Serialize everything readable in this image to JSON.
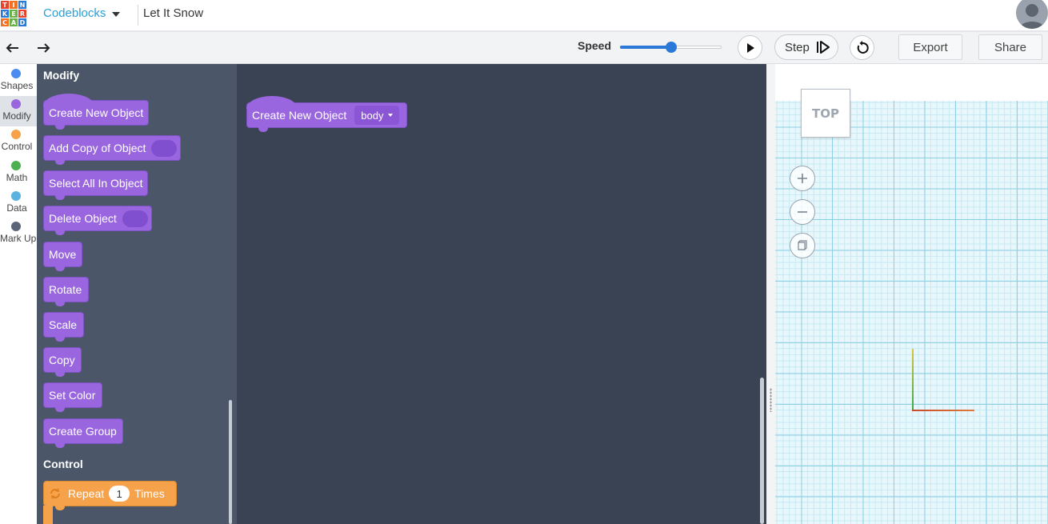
{
  "header": {
    "logo_letters": [
      "T",
      "I",
      "N",
      "K",
      "E",
      "R",
      "C",
      "A",
      "D"
    ],
    "logo_colors": [
      "#e8412c",
      "#f36f21",
      "#2a79d8",
      "#2a79d8",
      "#68b148",
      "#e8412c",
      "#f36f21",
      "#68b148",
      "#2a79d8"
    ],
    "app_name": "Codeblocks",
    "document_title": "Let It Snow"
  },
  "toolbar": {
    "speed_label": "Speed",
    "speed_value": 0.5,
    "step_label": "Step",
    "export_label": "Export",
    "share_label": "Share"
  },
  "categories": [
    {
      "label": "Shapes",
      "color": "#4a8cf0",
      "active": false
    },
    {
      "label": "Modify",
      "color": "#9966e0",
      "active": true
    },
    {
      "label": "Control",
      "color": "#f6a24a",
      "active": false
    },
    {
      "label": "Math",
      "color": "#4caf50",
      "active": false
    },
    {
      "label": "Data",
      "color": "#5ab2e0",
      "active": false
    },
    {
      "label": "Mark Up",
      "color": "#5c6478",
      "active": false
    }
  ],
  "flyout": {
    "modify_title": "Modify",
    "control_title": "Control",
    "blocks": [
      {
        "label": "Create New Object"
      },
      {
        "label": "Add Copy of Object"
      },
      {
        "label": "Select All In Object"
      },
      {
        "label": "Delete Object"
      },
      {
        "label": "Move"
      },
      {
        "label": "Rotate"
      },
      {
        "label": "Scale"
      },
      {
        "label": "Copy"
      },
      {
        "label": "Set Color"
      },
      {
        "label": "Create Group"
      }
    ],
    "repeat_block": {
      "label": "Repeat",
      "count": "1",
      "suffix": "Times"
    }
  },
  "workspace": {
    "block_label": "Create New Object",
    "block_dropdown": "body"
  },
  "viewer": {
    "viewcube_label": "TOP"
  }
}
